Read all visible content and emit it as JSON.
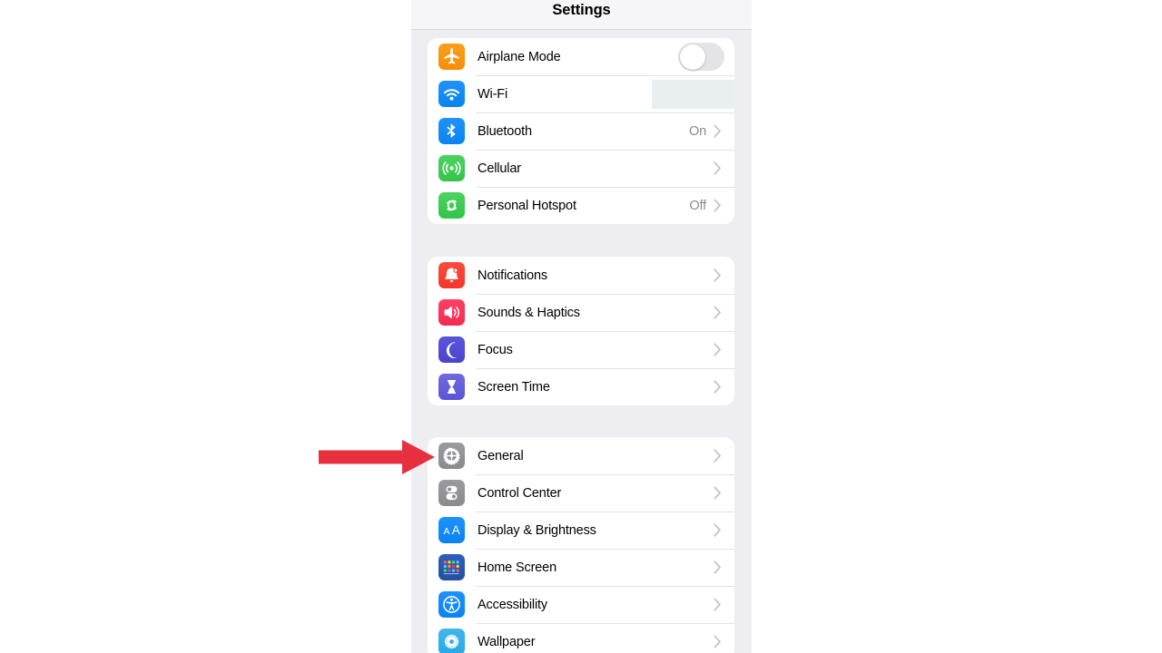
{
  "panel": {
    "title": "Settings"
  },
  "annotation": {
    "arrow_color": "#e6303f",
    "points_at": "General"
  },
  "redaction": {
    "color": "#e9eff0",
    "applies_to": "Wi-Fi value"
  },
  "groups": [
    {
      "id": "connectivity",
      "rows": [
        {
          "label": "Airplane Mode",
          "icon": "airplane-icon",
          "icon_color": "#f88d09",
          "control": "toggle",
          "toggle_on": false,
          "value": "",
          "chevron": false
        },
        {
          "label": "Wi-Fi",
          "icon": "wifi-icon",
          "icon_color": "#0a84f0",
          "control": "redacted",
          "value": "",
          "chevron": false
        },
        {
          "label": "Bluetooth",
          "icon": "bluetooth-icon",
          "icon_color": "#0a84f0",
          "control": "value",
          "value": "On",
          "chevron": true
        },
        {
          "label": "Cellular",
          "icon": "cellular-icon",
          "icon_color": "#33c449",
          "control": "value",
          "value": "",
          "chevron": true
        },
        {
          "label": "Personal Hotspot",
          "icon": "hotspot-icon",
          "icon_color": "#33c449",
          "control": "value",
          "value": "Off",
          "chevron": true
        }
      ]
    },
    {
      "id": "notifications",
      "rows": [
        {
          "label": "Notifications",
          "icon": "bell-icon",
          "icon_color": "#f5352a",
          "control": "value",
          "value": "",
          "chevron": true
        },
        {
          "label": "Sounds & Haptics",
          "icon": "speaker-icon",
          "icon_color": "#f42a53",
          "control": "value",
          "value": "",
          "chevron": true
        },
        {
          "label": "Focus",
          "icon": "moon-icon",
          "icon_color": "#4a43ce",
          "control": "value",
          "value": "",
          "chevron": true
        },
        {
          "label": "Screen Time",
          "icon": "hourglass-icon",
          "icon_color": "#5b55d6",
          "control": "value",
          "value": "",
          "chevron": true
        }
      ]
    },
    {
      "id": "system",
      "rows": [
        {
          "label": "General",
          "icon": "gear-icon",
          "icon_color": "#8a8a8f",
          "control": "value",
          "value": "",
          "chevron": true
        },
        {
          "label": "Control Center",
          "icon": "sliders-icon",
          "icon_color": "#8a8a8f",
          "control": "value",
          "value": "",
          "chevron": true
        },
        {
          "label": "Display & Brightness",
          "icon": "text-size-icon",
          "icon_color": "#0a84f0",
          "control": "value",
          "value": "",
          "chevron": true
        },
        {
          "label": "Home Screen",
          "icon": "app-grid-icon",
          "icon_color": "#24509f",
          "control": "value",
          "value": "",
          "chevron": true
        },
        {
          "label": "Accessibility",
          "icon": "accessibility-icon",
          "icon_color": "#0a84f0",
          "control": "value",
          "value": "",
          "chevron": true
        },
        {
          "label": "Wallpaper",
          "icon": "flower-icon",
          "icon_color": "#27a8e4",
          "control": "value",
          "value": "",
          "chevron": true
        }
      ]
    }
  ]
}
